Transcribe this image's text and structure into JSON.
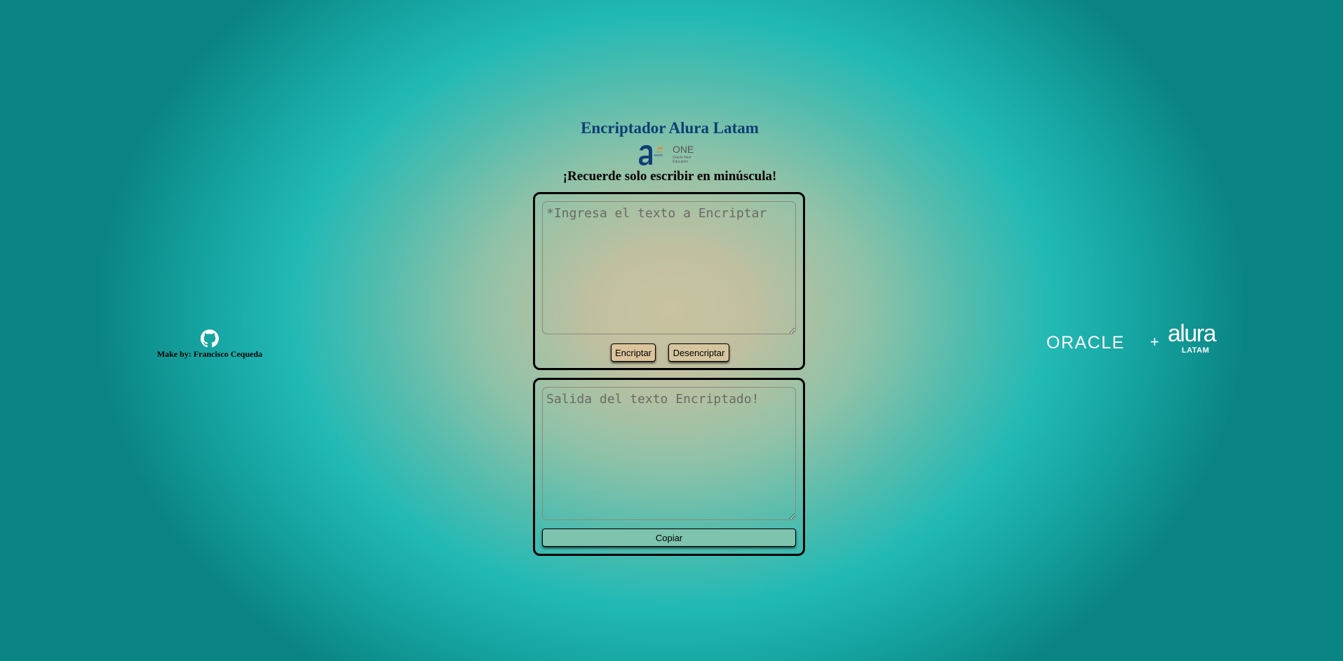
{
  "header": {
    "title": "Encriptador Alura Latam",
    "logo_text": "ONE",
    "logo_subtext_1": "Oracle Next",
    "logo_subtext_2": "Education",
    "reminder": "¡Recuerde solo escribir en minúscula!"
  },
  "input_panel": {
    "placeholder": "*Ingresa el texto a Encriptar",
    "value": "",
    "encrypt_label": "Encriptar",
    "decrypt_label": "Desencriptar"
  },
  "output_panel": {
    "placeholder": "Salida del texto Encriptado!",
    "value": "",
    "copy_label": "Copiar"
  },
  "credit": {
    "icon": "github-icon",
    "text": "Make by: Francisco Cequeda"
  },
  "partner_logo": {
    "oracle": "ORACLE",
    "plus": "+",
    "alura": "alura",
    "latam": "LATAM"
  },
  "colors": {
    "title": "#0e3e74",
    "encrypt_button": "#dbc49b",
    "decrypt_button": "#d5c69f",
    "copy_button": "#7dc3ad",
    "background_center": "#c8c3a0",
    "background_ring": "#22b9b5",
    "background_edge": "#0a8482"
  }
}
